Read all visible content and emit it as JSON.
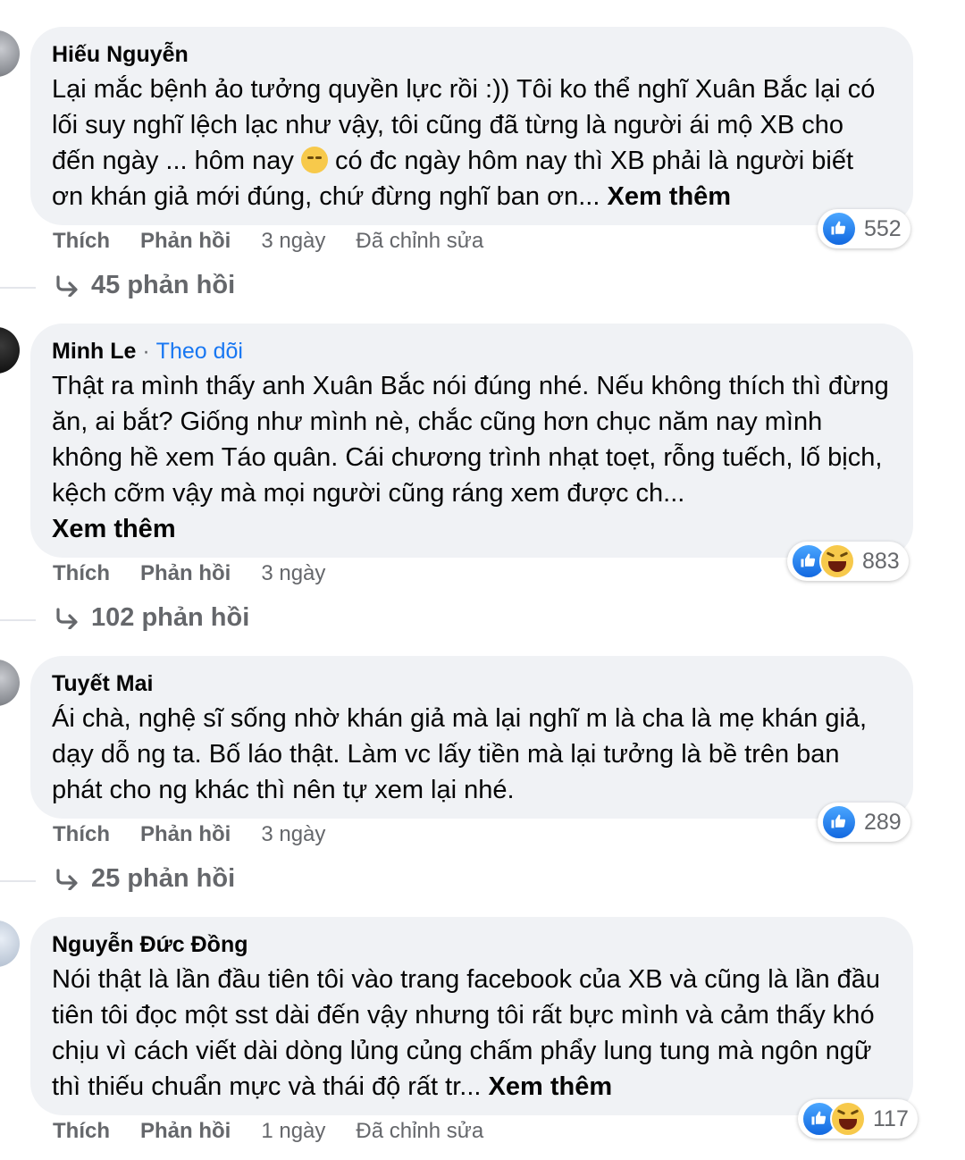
{
  "comments": [
    {
      "author": "Hiếu Nguyễn",
      "text_before_emoji": "Lại mắc bệnh ảo tưởng quyền lực rồi :)) Tôi ko thể nghĩ Xuân Bắc lại có lối suy nghĩ lệch lạc như vậy, tôi cũng đã từng là người ái mộ XB cho đến ngày ... hôm nay ",
      "emoji": "pensive-face-emoji",
      "text_after_emoji": " có đc ngày hôm nay thì XB phải là người biết ơn khán giả mới đúng, chứ đừng nghĩ ban ơn...",
      "see_more": "Xem thêm",
      "like_label": "Thích",
      "reply_label": "Phản hồi",
      "time": "3 ngày",
      "edited": "Đã chỉnh sửa",
      "reaction_icons": [
        "like-icon"
      ],
      "reaction_count": "552",
      "replies_label": "45 phản hồi"
    },
    {
      "author": "Minh Le",
      "follow_sep": "·",
      "follow_label": "Theo dõi",
      "text": "Thật ra mình thấy anh Xuân Bắc nói đúng nhé. Nếu không thích thì đừng ăn, ai bắt? Giống như mình nè, chắc cũng hơn chục năm nay mình không hề xem Táo quân. Cái chương trình nhạt toẹt, rỗng tuếch, lố bịch, kệch cỡm vậy mà mọi người cũng ráng xem được ch...",
      "see_more": "Xem thêm",
      "like_label": "Thích",
      "reply_label": "Phản hồi",
      "time": "3 ngày",
      "reaction_icons": [
        "like-icon",
        "haha-icon"
      ],
      "reaction_count": "883",
      "replies_label": "102 phản hồi"
    },
    {
      "author": "Tuyết Mai",
      "text": "Ái chà, nghệ sĩ sống nhờ khán giả mà lại nghĩ m là cha là mẹ khán giả, dạy dỗ ng ta. Bố láo thật. Làm vc lấy tiền mà lại tưởng là bề trên ban phát cho ng khác thì nên tự xem lại nhé.",
      "like_label": "Thích",
      "reply_label": "Phản hồi",
      "time": "3 ngày",
      "reaction_icons": [
        "like-icon"
      ],
      "reaction_count": "289",
      "replies_label": "25 phản hồi"
    },
    {
      "author": "Nguyễn Đức Đồng",
      "text": "Nói thật là lần đầu tiên tôi vào trang facebook của XB và cũng là lần đầu tiên tôi đọc một sst dài đến vậy nhưng tôi rất bực mình và cảm thấy khó chịu vì cách viết dài dòng lủng củng chấm phẩy lung tung mà ngôn ngữ thì thiếu chuẩn mực và thái độ rất tr...",
      "see_more": "Xem thêm",
      "like_label": "Thích",
      "reply_label": "Phản hồi",
      "time": "1 ngày",
      "edited": "Đã chỉnh sửa",
      "reaction_icons": [
        "like-icon",
        "haha-icon"
      ],
      "reaction_count": "117"
    }
  ]
}
